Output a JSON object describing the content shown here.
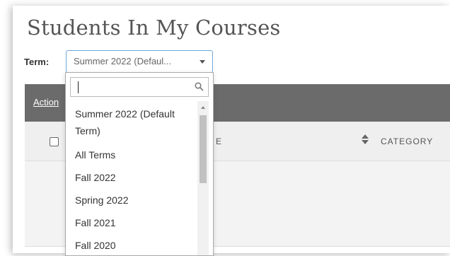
{
  "page": {
    "title": "Students In My Courses"
  },
  "term": {
    "label": "Term:",
    "selected": "Summer 2022 (Defaul...",
    "search_value": "",
    "options": [
      "Summer 2022 (Default Term)",
      "All Terms",
      "Fall 2022",
      "Spring 2022",
      "Fall 2021",
      "Fall 2020"
    ]
  },
  "toolbar": {
    "action_label": "Action"
  },
  "table": {
    "columns": [
      "E",
      "CATEGORY"
    ]
  },
  "icons": {
    "search": "search-icon",
    "caret": "chevron-down-icon",
    "sort": "sort-icon"
  },
  "colors": {
    "toolbar_bg": "#6b6b6b",
    "select_border": "#6fa8dc",
    "header_bg": "#efefef"
  }
}
